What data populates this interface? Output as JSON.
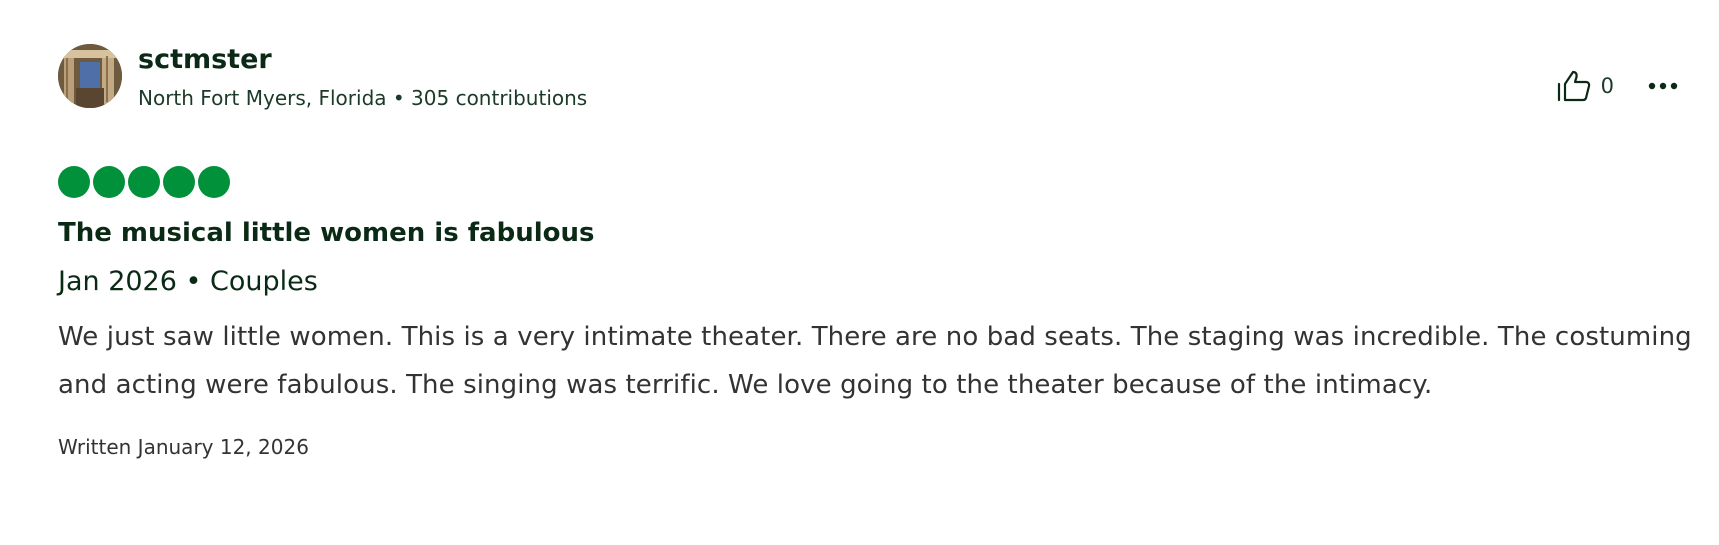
{
  "reviewer": {
    "username": "sctmster",
    "location": "North Fort Myers, Florida",
    "separator": "•",
    "contributions": "305 contributions"
  },
  "actions": {
    "helpful_icon": "thumbs-up-icon",
    "helpful_count": "0",
    "more_icon": "more-options-icon"
  },
  "rating": {
    "value": 5,
    "max": 5,
    "color": "#00913a"
  },
  "review": {
    "title": "The musical little women is fabulous",
    "trip_info": "Jan 2026 • Couples",
    "body": "We just saw little women. This is a very intimate theater. There are no bad seats. The staging was incredible. The costuming and acting were fabulous. The singing was terrific. We love going to the theater because of the intimacy.",
    "written_date": "Written January 12, 2026"
  }
}
